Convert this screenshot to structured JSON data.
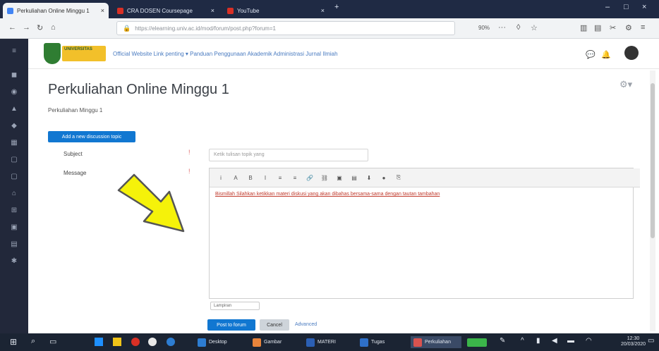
{
  "browser": {
    "tabs": [
      {
        "title": "Perkuliahan Online Minggu 1",
        "color": "#4285f4",
        "active": true
      },
      {
        "title": "CRA DOSEN Coursepage",
        "color": "#d93025",
        "active": false
      },
      {
        "title": "YouTube",
        "color": "#d93025",
        "active": false
      }
    ],
    "url": "https://elearning.univ.ac.id/mod/forum/post.php?forum=1",
    "zoom": "90%"
  },
  "moodle": {
    "logo_text": "UNIVERSITAS",
    "nav_text": "Official Website    Link penting ▾    Panduan Penggunaan    Akademik    Administrasi    Jurnal Ilmiah"
  },
  "page": {
    "title": "Perkuliahan Online Minggu 1",
    "subtitle": "Perkuliahan Minggu 1",
    "add_button": "Add a new discussion topic",
    "subject_label": "Subject",
    "message_label": "Message",
    "required_mark": "!",
    "subject_placeholder": "Ketik tulisan topik yang",
    "editor_text_link1": "Bismillah Silahkan ketikkan materi diskusi yang",
    "editor_text_normal1": " ",
    "editor_text_link2": "akan dibahas bersama-sama",
    "editor_text_normal2": " ",
    "editor_text_link3": "dengan tautan tambahan",
    "attach_label": "Lampiran",
    "post_button": "Post to forum",
    "cancel_button": "Cancel",
    "advanced_link": "Advanced"
  },
  "toolbar_icons": [
    "i",
    "A",
    "B",
    "I",
    "≡",
    "≡",
    "🔗",
    "⛓",
    "▣",
    "▤",
    "⬇",
    "●",
    "⎘"
  ],
  "taskbar": {
    "apps": [
      {
        "label": "Desktop",
        "color": "#2d7dd2"
      },
      {
        "label": "Gambar",
        "color": "#e8843b"
      },
      {
        "label": "MATERI",
        "color": "#2b5fb4"
      },
      {
        "label": "Tugas",
        "color": "#2e70c9"
      },
      {
        "label": "Perkuliahan",
        "color": "#d9534f"
      },
      {
        "label": "",
        "color": "#3bb54a"
      }
    ],
    "time": "12:30",
    "date": "20/03/2020"
  },
  "colors": {
    "accent": "#1177d1",
    "arrow": "#f5f20a"
  }
}
